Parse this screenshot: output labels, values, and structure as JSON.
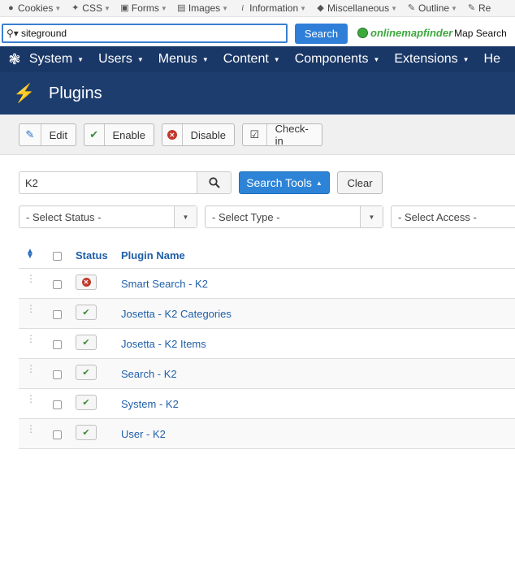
{
  "webdev_toolbar": {
    "items": [
      {
        "label": "Cookies",
        "icon": "person-icon"
      },
      {
        "label": "CSS",
        "icon": "wand-icon"
      },
      {
        "label": "Forms",
        "icon": "briefcase-icon"
      },
      {
        "label": "Images",
        "icon": "image-icon"
      },
      {
        "label": "Information",
        "icon": "info-icon"
      },
      {
        "label": "Miscellaneous",
        "icon": "cube-icon"
      },
      {
        "label": "Outline",
        "icon": "pencil-icon"
      },
      {
        "label": "Re",
        "icon": "marker-icon"
      }
    ]
  },
  "searchbar": {
    "query": "siteground",
    "button": "Search",
    "brand_part1": "online",
    "brand_part2": "mapfinder",
    "brand_suffix": "Map Search"
  },
  "navbar": {
    "items": [
      "System",
      "Users",
      "Menus",
      "Content",
      "Components",
      "Extensions",
      "He"
    ]
  },
  "header": {
    "title": "Plugins"
  },
  "toolbar": {
    "edit": "Edit",
    "enable": "Enable",
    "disable": "Disable",
    "checkin": "Check-in"
  },
  "filters": {
    "search_value": "K2",
    "search_tools": "Search Tools",
    "clear": "Clear",
    "status": "- Select Status -",
    "type": "- Select Type -",
    "access": "- Select Access -"
  },
  "table": {
    "headers": {
      "status": "Status",
      "name": "Plugin Name"
    },
    "rows": [
      {
        "name": "Smart Search - K2",
        "enabled": false
      },
      {
        "name": "Josetta - K2 Categories",
        "enabled": true
      },
      {
        "name": "Josetta - K2 Items",
        "enabled": true
      },
      {
        "name": "Search - K2",
        "enabled": true
      },
      {
        "name": "System - K2",
        "enabled": true
      },
      {
        "name": "User - K2",
        "enabled": true
      }
    ]
  },
  "colors": {
    "navbar": "#1a3867",
    "header": "#1c3d6e",
    "primary": "#2d84d7",
    "link": "#1f5fa8",
    "enabled": "#3a8a3a",
    "disabled": "#c0392b"
  }
}
